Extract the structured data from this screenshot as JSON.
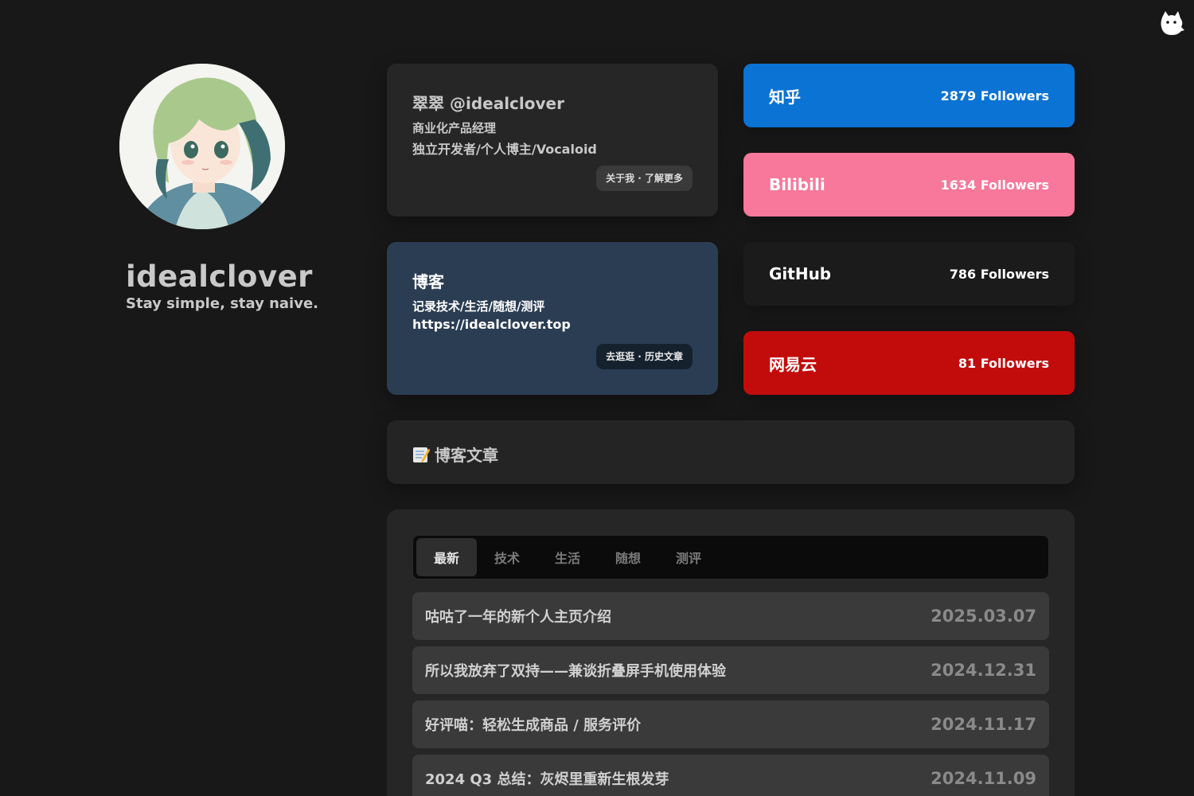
{
  "theme_toggle": {
    "icon": "cat-icon"
  },
  "profile": {
    "name": "idealclover",
    "motto": "Stay simple, stay naive.",
    "avatar_icon": "anime-avatar"
  },
  "intro_card": {
    "title": "翠翠 @idealclover",
    "line1": "商业化产品经理",
    "line2": "独立开发者/个人博主/Vocaloid",
    "button": "关于我 · 了解更多"
  },
  "blog_card": {
    "title": "博客",
    "line1": "记录技术/生活/随想/测评",
    "line2": "https://idealclover.top",
    "button": "去逛逛 · 历史文章"
  },
  "socials": [
    {
      "name": "知乎",
      "followers": "2879 Followers",
      "color": "#0a73d4"
    },
    {
      "name": "Bilibili",
      "followers": "1634 Followers",
      "color": "#f7789a"
    },
    {
      "name": "GitHub",
      "followers": "786 Followers",
      "color": "#1b1b1b"
    },
    {
      "name": "网易云",
      "followers": "81 Followers",
      "color": "#c20c0c"
    }
  ],
  "section": {
    "title": "博客文章",
    "icon": "memo-icon"
  },
  "tabs": [
    "最新",
    "技术",
    "生活",
    "随想",
    "测评"
  ],
  "active_tab": "最新",
  "posts": [
    {
      "title": "咕咕了一年的新个人主页介绍",
      "date": "2025.03.07"
    },
    {
      "title": "所以我放弃了双持——兼谈折叠屏手机使用体验",
      "date": "2024.12.31"
    },
    {
      "title": "好评喵：轻松生成商品 / 服务评价",
      "date": "2024.11.17"
    },
    {
      "title": "2024 Q3 总结：灰烬里重新生根发芽",
      "date": "2024.11.09"
    }
  ]
}
